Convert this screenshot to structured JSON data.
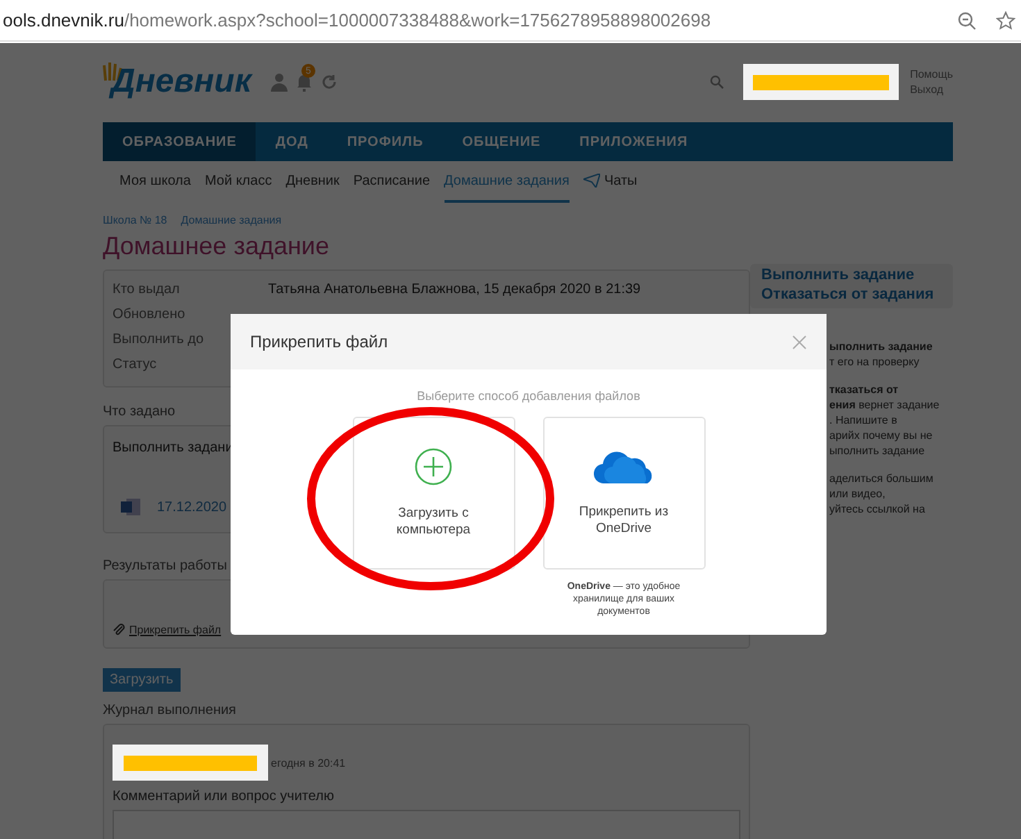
{
  "address_bar": {
    "domain": "ools.dnevnik.ru",
    "path": "/homework.aspx?school=1000007338488&work=1756278958898002698"
  },
  "header": {
    "logo": "Дневник",
    "notification_count": "5",
    "links": [
      "Помощь",
      "Выход"
    ]
  },
  "nav": [
    {
      "label": "ОБРАЗОВАНИЕ",
      "selected": true
    },
    {
      "label": "ДОД",
      "selected": false
    },
    {
      "label": "ПРОФИЛЬ",
      "selected": false
    },
    {
      "label": "ОБЩЕНИЕ",
      "selected": false
    },
    {
      "label": "ПРИЛОЖЕНИЯ",
      "selected": false
    }
  ],
  "subnav": [
    {
      "label": "Моя школа",
      "selected": false,
      "kind": "plain"
    },
    {
      "label": "Мой класс",
      "selected": false,
      "kind": "plain"
    },
    {
      "label": "Дневник",
      "selected": false,
      "kind": "plain"
    },
    {
      "label": "Расписание",
      "selected": false,
      "kind": "plain"
    },
    {
      "label": "Домашние задания",
      "selected": true,
      "kind": "plain"
    },
    {
      "label": "Чаты",
      "selected": false,
      "kind": "chat"
    }
  ],
  "breadcrumbs": [
    "Школа № 18",
    "Домашние задания"
  ],
  "title": "Домашнее задание",
  "info_rows": [
    {
      "label": "Кто выдал",
      "value": "Татьяна Анатольевна Блажнова, 15 декабря 2020 в 21:39"
    },
    {
      "label": "Обновлено"
    },
    {
      "label": "Выполнить до"
    },
    {
      "label": "Статус"
    }
  ],
  "task": {
    "heading": "Что задано",
    "text": "Выполнить задани",
    "file": "17.12.2020"
  },
  "results": {
    "heading": "Результаты работы",
    "attach_link": "Прикрепить файл",
    "upload_button": "Загрузить"
  },
  "journal": {
    "heading": "Журнал выполнения",
    "entry_time": "егодня в 20:41",
    "comment_label": "Комментарий или вопрос учителю"
  },
  "actions": [
    "Выполнить задание",
    "Отказаться от задания"
  ],
  "help_lines": [
    {
      "kind": "strong",
      "text": "ыполнить задание"
    },
    {
      "kind": "plain",
      "text": "т его на проверку"
    },
    {
      "kind": "gap"
    },
    {
      "kind": "strong",
      "text": "тказаться от"
    },
    {
      "kind": "plain",
      "text": "**ения** вернет задание"
    },
    {
      "kind": "plain",
      "text": ". Напишите в"
    },
    {
      "kind": "plain",
      "text": "арийх почему вы не"
    },
    {
      "kind": "plain",
      "text": "ыполнить задание"
    },
    {
      "kind": "gap"
    },
    {
      "kind": "plain",
      "text": "аделиться большим"
    },
    {
      "kind": "plain",
      "text": "или видео,"
    },
    {
      "kind": "plain",
      "text": "уйтесь ссылкой на"
    }
  ],
  "dialog": {
    "title": "Прикрепить файл",
    "subtitle": "Выберите способ добавления файлов",
    "options": [
      {
        "kind": "computer",
        "label": "Загрузить с компьютера"
      },
      {
        "kind": "onedrive",
        "label": "Прикрепить из OneDrive",
        "note": "**OneDrive** — это удобное хранилище для ваших документов"
      }
    ]
  }
}
